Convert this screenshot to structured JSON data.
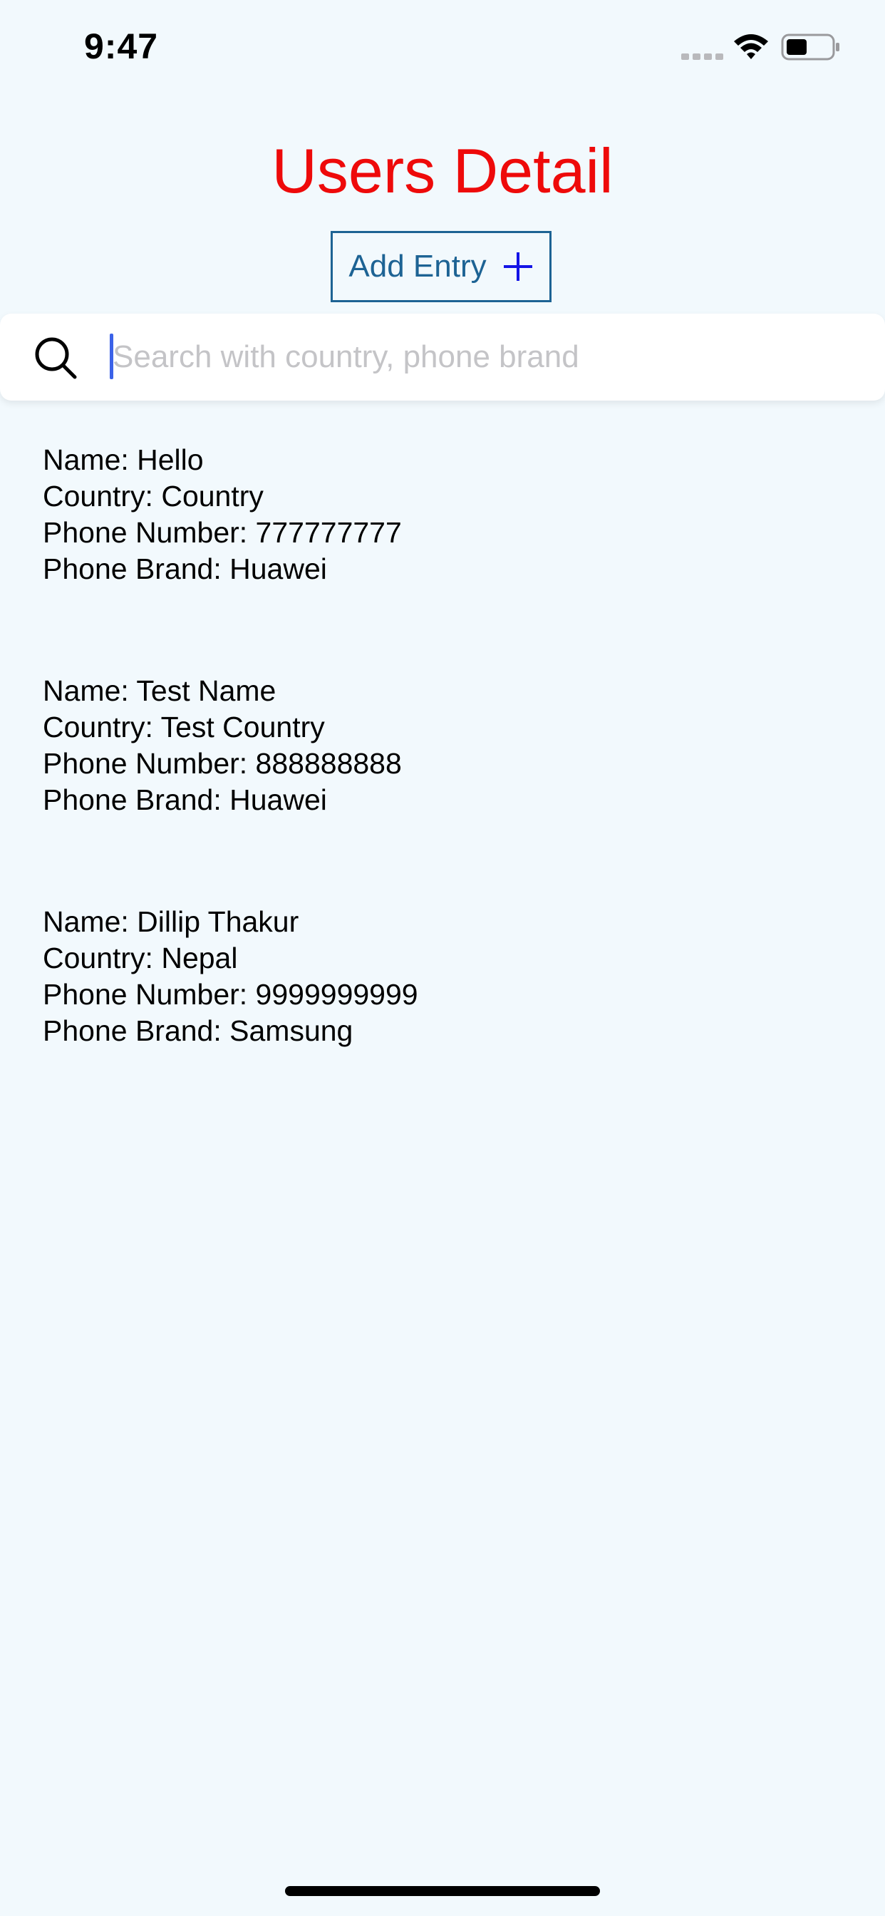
{
  "status_bar": {
    "time": "9:47",
    "icons": [
      "signal-dots-icon",
      "wifi-icon",
      "battery-icon"
    ]
  },
  "header": {
    "title": "Users Detail",
    "add_entry_label": "Add Entry",
    "add_entry_icon": "plus-icon"
  },
  "search": {
    "value": "",
    "placeholder": "Search with country, phone brand",
    "icon": "search-icon"
  },
  "users": [
    {
      "name": "Name: Hello",
      "country": "Country: Country",
      "phone_number": "Phone Number: 777777777",
      "phone_brand": "Phone Brand: Huawei"
    },
    {
      "name": "Name: Test Name",
      "country": "Country: Test Country",
      "phone_number": "Phone Number: 888888888",
      "phone_brand": "Phone Brand: Huawei"
    },
    {
      "name": "Name: Dillip Thakur",
      "country": "Country: Nepal",
      "phone_number": "Phone Number: 9999999999",
      "phone_brand": "Phone Brand: Samsung"
    }
  ],
  "colors": {
    "background": "#f2f9fd",
    "title": "#ee0a0a",
    "button": "#1d6394",
    "plus": "#1414e6",
    "cursor": "#3b62e8",
    "placeholder": "#c4c4c7"
  }
}
